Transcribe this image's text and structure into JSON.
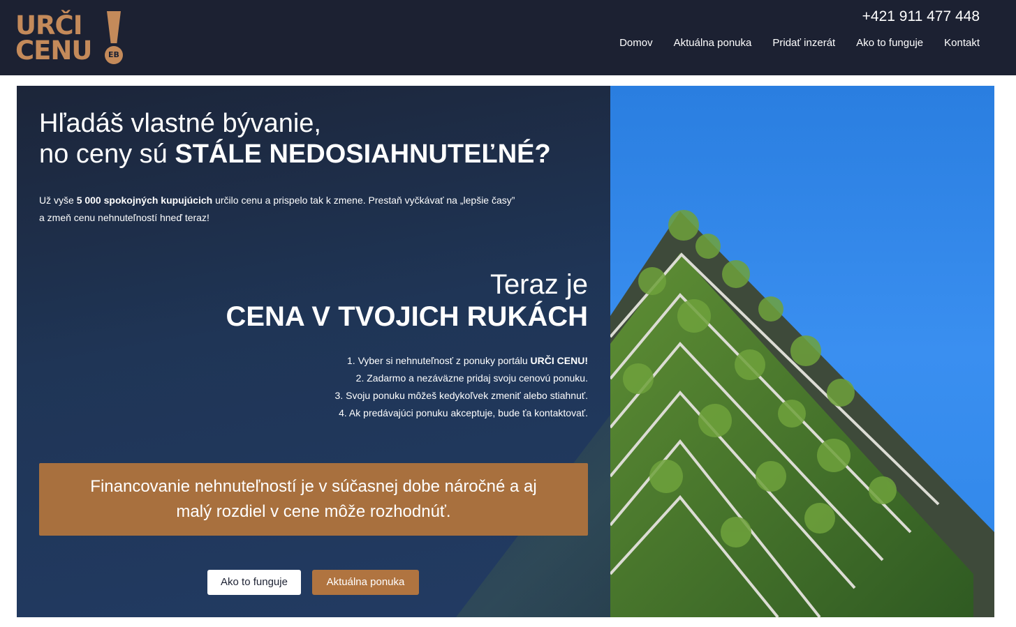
{
  "header": {
    "logo": {
      "line1": "URČI",
      "line2": "CENU",
      "badge": "EB"
    },
    "phone": "+421 911 477 448",
    "nav": [
      "Domov",
      "Aktuálna ponuka",
      "Pridať inzerát",
      "Ako to funguje",
      "Kontakt"
    ]
  },
  "hero": {
    "title_line1": "Hľadáš vlastné bývanie,",
    "title_line2_prefix": "no ceny sú ",
    "title_line2_bold": "STÁLE NEDOSIAHNUTEĽNÉ?",
    "intro_prefix": "Už vyše ",
    "intro_bold": "5 000 spokojných kupujúcich",
    "intro_suffix": " určilo cenu a prispelo tak k zmene. Prestaň vyčkávať na „lepšie časy”",
    "intro_line2": "a zmeň cenu nehnuteľností hneď teraz!",
    "subtitle_line1": "Teraz je",
    "subtitle_line2": "CENA V TVOJICH RUKÁCH",
    "steps": [
      {
        "text": "1. Vyber si nehnuteľnosť z ponuky portálu ",
        "bold": "URČI CENU!"
      },
      {
        "text": "2. Zadarmo a nezáväzne pridaj svoju cenovú ponuku.",
        "bold": ""
      },
      {
        "text": "3. Svoju ponuku môžeš kedykoľvek zmeniť alebo stiahnuť.",
        "bold": ""
      },
      {
        "text": "4. Ak predávajúci ponuku akceptuje, bude ťa kontaktovať.",
        "bold": ""
      }
    ],
    "callout_line1": "Financovanie nehnuteľností je v súčasnej dobe náročné a aj",
    "callout_line2": "malý rozdiel v cene môže rozhodnúť.",
    "button_secondary": "Ako to funguje",
    "button_primary": "Aktuálna ponuka"
  },
  "colors": {
    "header_bg": "#1c2132",
    "brand": "#c48a5a",
    "accent": "#a8703e",
    "sky": "#2f86e8",
    "foliage": "#4d7a2e"
  },
  "icons": {
    "photo": "green-building-photo"
  }
}
